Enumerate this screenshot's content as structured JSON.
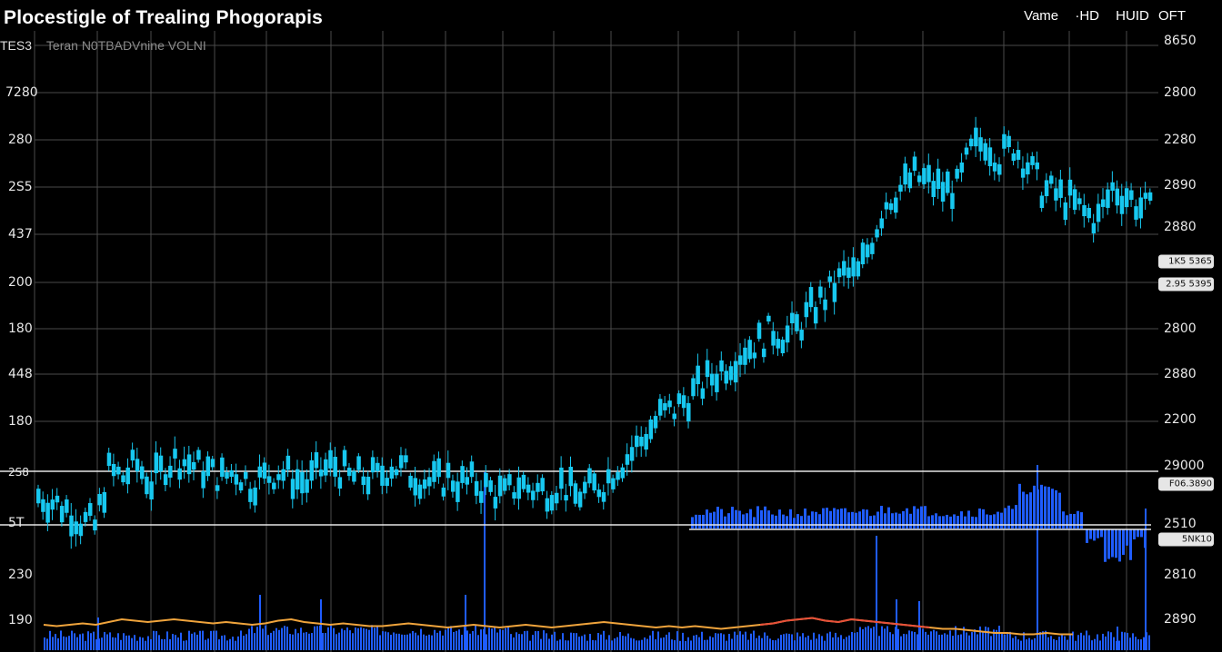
{
  "header": {
    "title": "Plocestigle of Trealing Phogorapis",
    "menu": [
      "Vame",
      "HD",
      "HUID",
      "OFT"
    ],
    "symbol": "TES3",
    "indicators": "Teran N0TBADVnine VOLNI"
  },
  "colors": {
    "background": "#000000",
    "candle": "#17c8f0",
    "volume": "#1f5cff",
    "overlay_orange": "#f0a43c",
    "overlay_red": "#e8503a",
    "grid": "#4a4a4a",
    "reference_line": "#e6e6e6"
  },
  "chart_data": {
    "type": "candlestick",
    "title": "Plocestigle of Trealing Phogorapis",
    "y_axis_left": [
      "7280",
      "280",
      "2S5",
      "437",
      "200",
      "180",
      "448",
      "180",
      "2S8",
      "5T",
      "230",
      "190"
    ],
    "y_axis_right": [
      "8650",
      "2800",
      "2280",
      "2890",
      "2880",
      "2800",
      "2880",
      "2200",
      "29000",
      "2510",
      "2810",
      "2890"
    ],
    "price_tags": [
      "1K5 5365",
      "2.95 5395",
      "F06.3890",
      "5NK10"
    ],
    "price_path": [
      68,
      67,
      66,
      64,
      63,
      72,
      71,
      73,
      70,
      73,
      74,
      73,
      72,
      71,
      72,
      70,
      71,
      72,
      71,
      70,
      72,
      73,
      71,
      71,
      71,
      73,
      72,
      71,
      70,
      71,
      70,
      70,
      69,
      68,
      70,
      69,
      69,
      70,
      68,
      69,
      70,
      73,
      75,
      78,
      81,
      82,
      84,
      86,
      88,
      90,
      92,
      93,
      95,
      94,
      96,
      99,
      101,
      104,
      104,
      110,
      116,
      118,
      120,
      119,
      118,
      118,
      124,
      126,
      123,
      125,
      122,
      118,
      117,
      116,
      114,
      113,
      118,
      117,
      115,
      114
    ],
    "overlay_path": [
      8,
      7,
      8,
      9,
      8,
      10,
      12,
      11,
      10,
      11,
      12,
      11,
      10,
      9,
      10,
      9,
      8,
      9,
      11,
      12,
      10,
      9,
      8,
      9,
      8,
      7,
      7,
      8,
      9,
      8,
      7,
      6,
      7,
      8,
      7,
      6,
      7,
      8,
      7,
      6,
      7,
      8,
      9,
      10,
      9,
      8,
      7,
      6,
      7,
      6,
      7,
      6,
      5,
      6,
      7,
      8,
      9,
      11,
      12,
      13,
      11,
      10,
      12,
      11,
      10,
      9,
      8,
      7,
      6,
      5,
      5,
      4,
      3,
      2,
      2,
      1,
      1,
      2,
      1,
      1
    ],
    "volume_mid_path": [
      20,
      21,
      19,
      20,
      18,
      21,
      20,
      19,
      18,
      22,
      20,
      19,
      21,
      20,
      24,
      26,
      27,
      23,
      22,
      20,
      19,
      21,
      20,
      22,
      25,
      21,
      20,
      19,
      18,
      17
    ]
  }
}
